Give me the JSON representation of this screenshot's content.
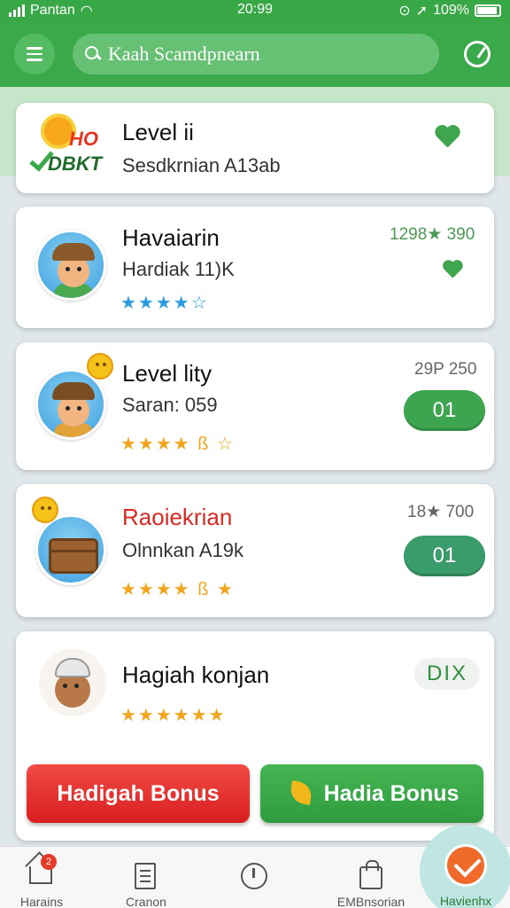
{
  "status_bar": {
    "carrier": "Pantan",
    "time": "20:99",
    "battery": "109%"
  },
  "search": {
    "placeholder": "Kaah Scamdpnearn"
  },
  "logo": {
    "top_text": "HO",
    "bottom_text": "DBKT"
  },
  "cards": [
    {
      "title": "Level ii",
      "subtitle": "Sesdkrnian A13ab",
      "stars": "",
      "stats": "",
      "action": ""
    },
    {
      "title": "Havaiarin",
      "subtitle": "Hardiak 11)K",
      "stars": "★★★★☆",
      "stats": "1298★ 390",
      "action": ""
    },
    {
      "title": "Level lity",
      "subtitle": "Saran: 059",
      "stars": "★★★★ ß ☆",
      "stats": "29P 250",
      "action": "01"
    },
    {
      "title": "Raoiekrian",
      "subtitle": "Olnnkan A19k",
      "stars": "★★★★ ß ★",
      "stats": "18★ 700",
      "action": "01"
    },
    {
      "title": "Hagiah konjan",
      "subtitle": "",
      "stars": "★★★★★★",
      "stats": "",
      "action": "DIX"
    }
  ],
  "buttons": {
    "left": "Hadigah Bonus",
    "right": "Hadia Bonus"
  },
  "tabs": [
    {
      "label": "Harains",
      "badge": "2"
    },
    {
      "label": "Cranon"
    },
    {
      "label": ""
    },
    {
      "label": "EMBnsorian"
    },
    {
      "label": "Havienhx"
    }
  ],
  "colors": {
    "primary_green": "#3aa94a",
    "accent_red": "#e53a2a",
    "fab_orange": "#f06a2a"
  }
}
